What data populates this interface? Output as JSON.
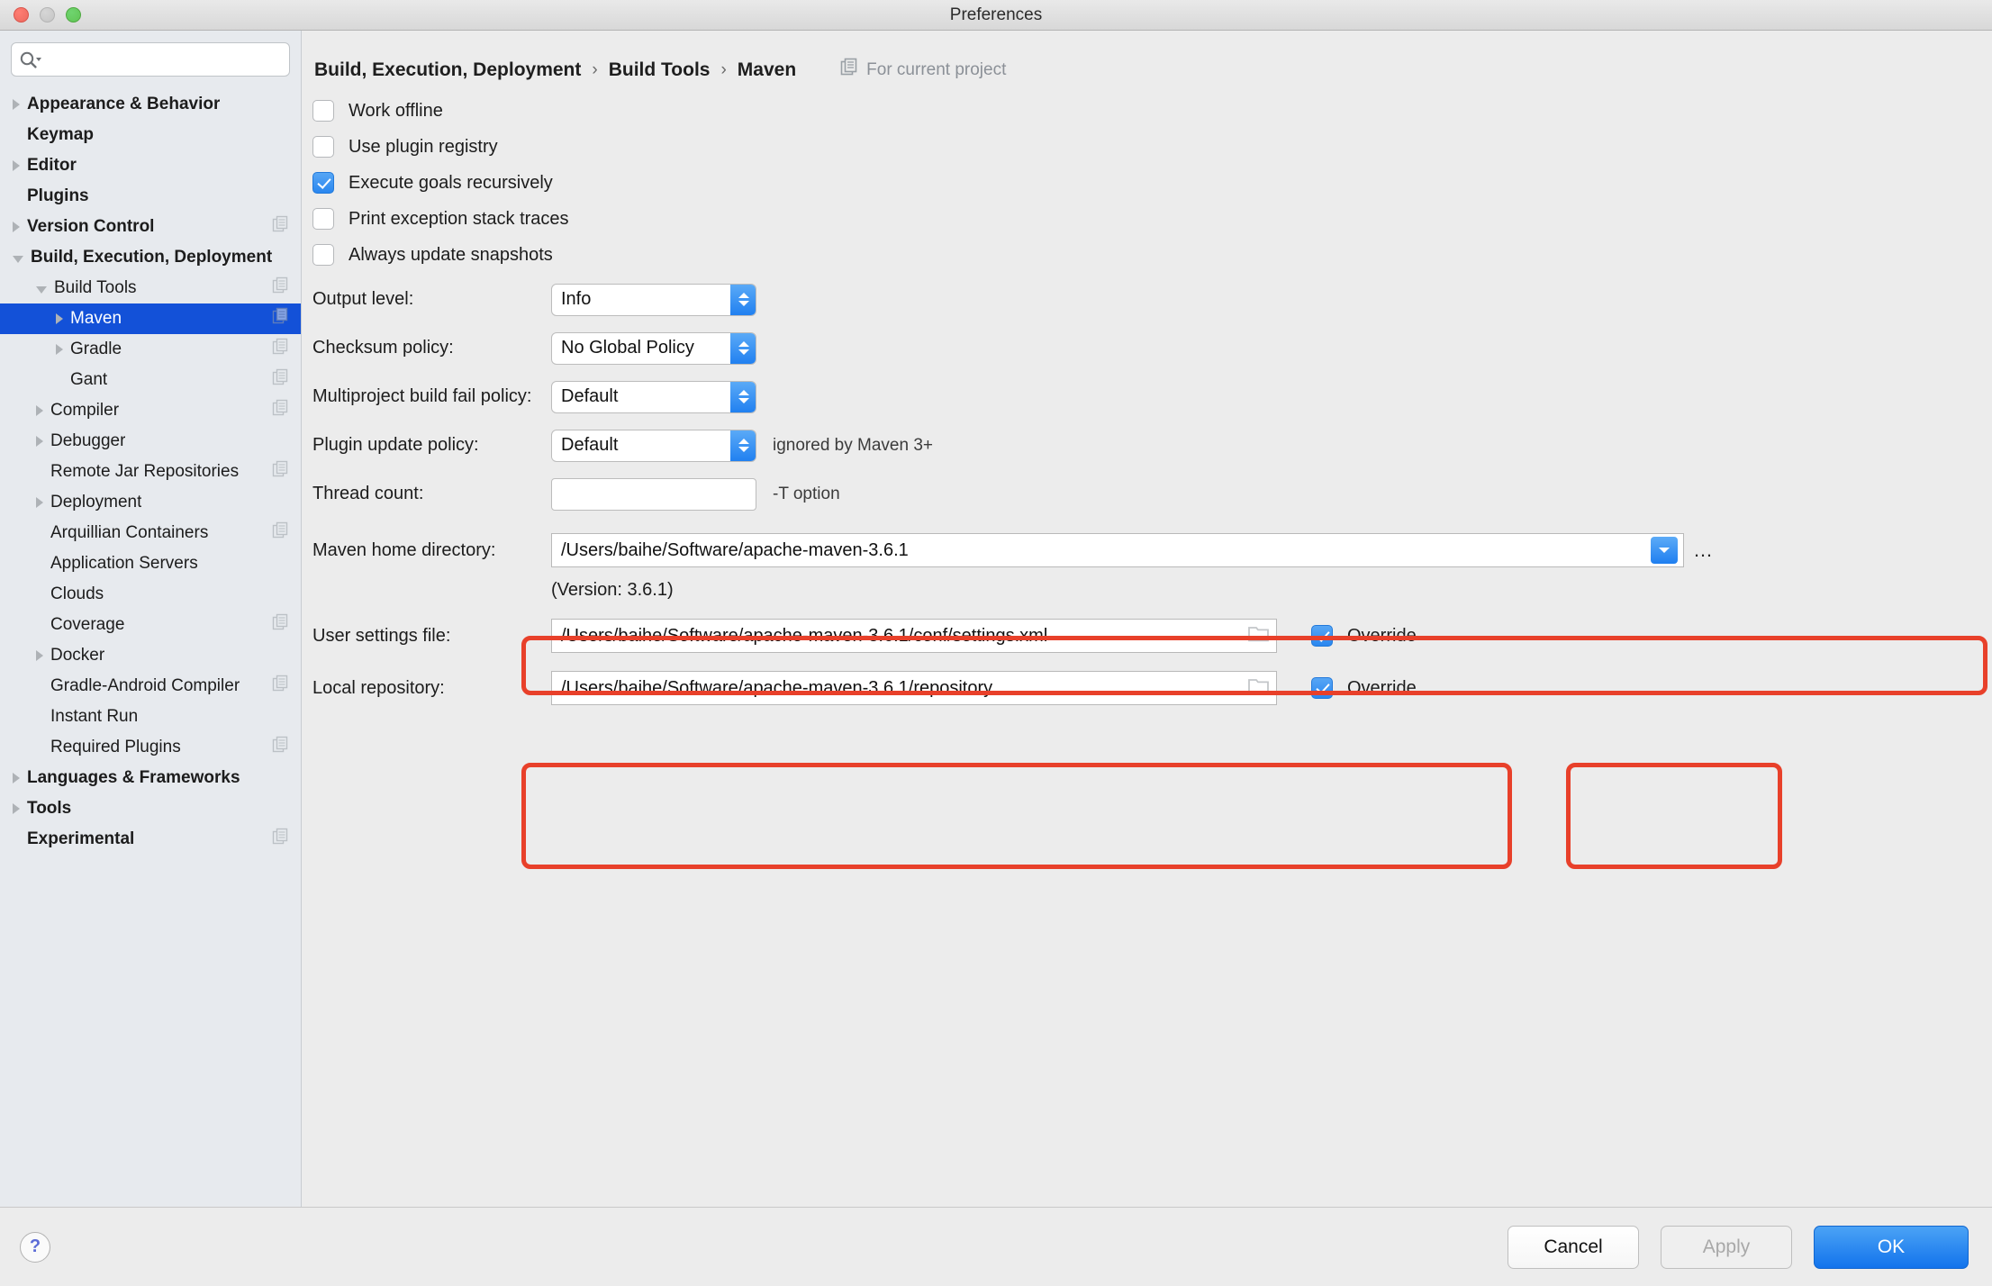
{
  "window": {
    "title": "Preferences"
  },
  "search": {
    "placeholder": "",
    "value": ""
  },
  "sidebar": {
    "items": [
      {
        "label": "Appearance & Behavior",
        "depth": 0,
        "arrow": "right",
        "bold": true,
        "selected": false,
        "badge": false
      },
      {
        "label": "Keymap",
        "depth": 0,
        "arrow": "none",
        "bold": true,
        "selected": false,
        "badge": false
      },
      {
        "label": "Editor",
        "depth": 0,
        "arrow": "right",
        "bold": true,
        "selected": false,
        "badge": false
      },
      {
        "label": "Plugins",
        "depth": 0,
        "arrow": "none",
        "bold": true,
        "selected": false,
        "badge": false
      },
      {
        "label": "Version Control",
        "depth": 0,
        "arrow": "right",
        "bold": true,
        "selected": false,
        "badge": true
      },
      {
        "label": "Build, Execution, Deployment",
        "depth": 0,
        "arrow": "down",
        "bold": true,
        "selected": false,
        "badge": false
      },
      {
        "label": "Build Tools",
        "depth": 1,
        "arrow": "down",
        "bold": false,
        "selected": false,
        "badge": true
      },
      {
        "label": "Maven",
        "depth": 2,
        "arrow": "right",
        "bold": false,
        "selected": true,
        "badge": true
      },
      {
        "label": "Gradle",
        "depth": 2,
        "arrow": "right",
        "bold": false,
        "selected": false,
        "badge": true
      },
      {
        "label": "Gant",
        "depth": 2,
        "arrow": "none",
        "bold": false,
        "selected": false,
        "badge": true
      },
      {
        "label": "Compiler",
        "depth": 1,
        "arrow": "right",
        "bold": false,
        "selected": false,
        "badge": true
      },
      {
        "label": "Debugger",
        "depth": 1,
        "arrow": "right",
        "bold": false,
        "selected": false,
        "badge": false
      },
      {
        "label": "Remote Jar Repositories",
        "depth": 1,
        "arrow": "none",
        "bold": false,
        "selected": false,
        "badge": true
      },
      {
        "label": "Deployment",
        "depth": 1,
        "arrow": "right",
        "bold": false,
        "selected": false,
        "badge": false
      },
      {
        "label": "Arquillian Containers",
        "depth": 1,
        "arrow": "none",
        "bold": false,
        "selected": false,
        "badge": true
      },
      {
        "label": "Application Servers",
        "depth": 1,
        "arrow": "none",
        "bold": false,
        "selected": false,
        "badge": false
      },
      {
        "label": "Clouds",
        "depth": 1,
        "arrow": "none",
        "bold": false,
        "selected": false,
        "badge": false
      },
      {
        "label": "Coverage",
        "depth": 1,
        "arrow": "none",
        "bold": false,
        "selected": false,
        "badge": true
      },
      {
        "label": "Docker",
        "depth": 1,
        "arrow": "right",
        "bold": false,
        "selected": false,
        "badge": false
      },
      {
        "label": "Gradle-Android Compiler",
        "depth": 1,
        "arrow": "none",
        "bold": false,
        "selected": false,
        "badge": true
      },
      {
        "label": "Instant Run",
        "depth": 1,
        "arrow": "none",
        "bold": false,
        "selected": false,
        "badge": false
      },
      {
        "label": "Required Plugins",
        "depth": 1,
        "arrow": "none",
        "bold": false,
        "selected": false,
        "badge": true
      },
      {
        "label": "Languages & Frameworks",
        "depth": 0,
        "arrow": "right",
        "bold": true,
        "selected": false,
        "badge": false
      },
      {
        "label": "Tools",
        "depth": 0,
        "arrow": "right",
        "bold": true,
        "selected": false,
        "badge": false
      },
      {
        "label": "Experimental",
        "depth": 0,
        "arrow": "none",
        "bold": true,
        "selected": false,
        "badge": true
      }
    ]
  },
  "header": {
    "breadcrumb": [
      "Build, Execution, Deployment",
      "Build Tools",
      "Maven"
    ],
    "separator": "›",
    "for_current_project": "For current project"
  },
  "main": {
    "checkboxes": [
      {
        "label": "Work offline",
        "checked": false
      },
      {
        "label": "Use plugin registry",
        "checked": false
      },
      {
        "label": "Execute goals recursively",
        "checked": true
      },
      {
        "label": "Print exception stack traces",
        "checked": false
      },
      {
        "label": "Always update snapshots",
        "checked": false
      }
    ],
    "fields": {
      "output_level": {
        "label": "Output level:",
        "value": "Info"
      },
      "checksum_policy": {
        "label": "Checksum policy:",
        "value": "No Global Policy"
      },
      "multiproject": {
        "label": "Multiproject build fail policy:",
        "value": "Default"
      },
      "plugin_update": {
        "label": "Plugin update policy:",
        "value": "Default",
        "hint": "ignored by Maven 3+"
      },
      "thread_count": {
        "label": "Thread count:",
        "value": "",
        "hint": "-T option"
      },
      "maven_home": {
        "label": "Maven home directory:",
        "value": "/Users/baihe/Software/apache-maven-3.6.1"
      },
      "version_note": "(Version: 3.6.1)",
      "user_settings": {
        "label": "User settings file:",
        "value": "/Users/baihe/Software/apache-maven-3.6.1/conf/settings.xml",
        "override_label": "Override",
        "override_checked": true
      },
      "local_repository": {
        "label": "Local repository:",
        "value": "/Users/baihe/Software/apache-maven-3.6.1/repository",
        "override_label": "Override",
        "override_checked": true
      }
    },
    "browse_button": "…"
  },
  "footer": {
    "help": "?",
    "cancel": "Cancel",
    "apply": "Apply",
    "ok": "OK"
  },
  "colors": {
    "selection_blue": "#1351d8",
    "accent_blue": "#1f7ff0",
    "annotation_red": "#e8402a",
    "sidebar_bg": "#e7eaee",
    "content_bg": "#ececec"
  }
}
